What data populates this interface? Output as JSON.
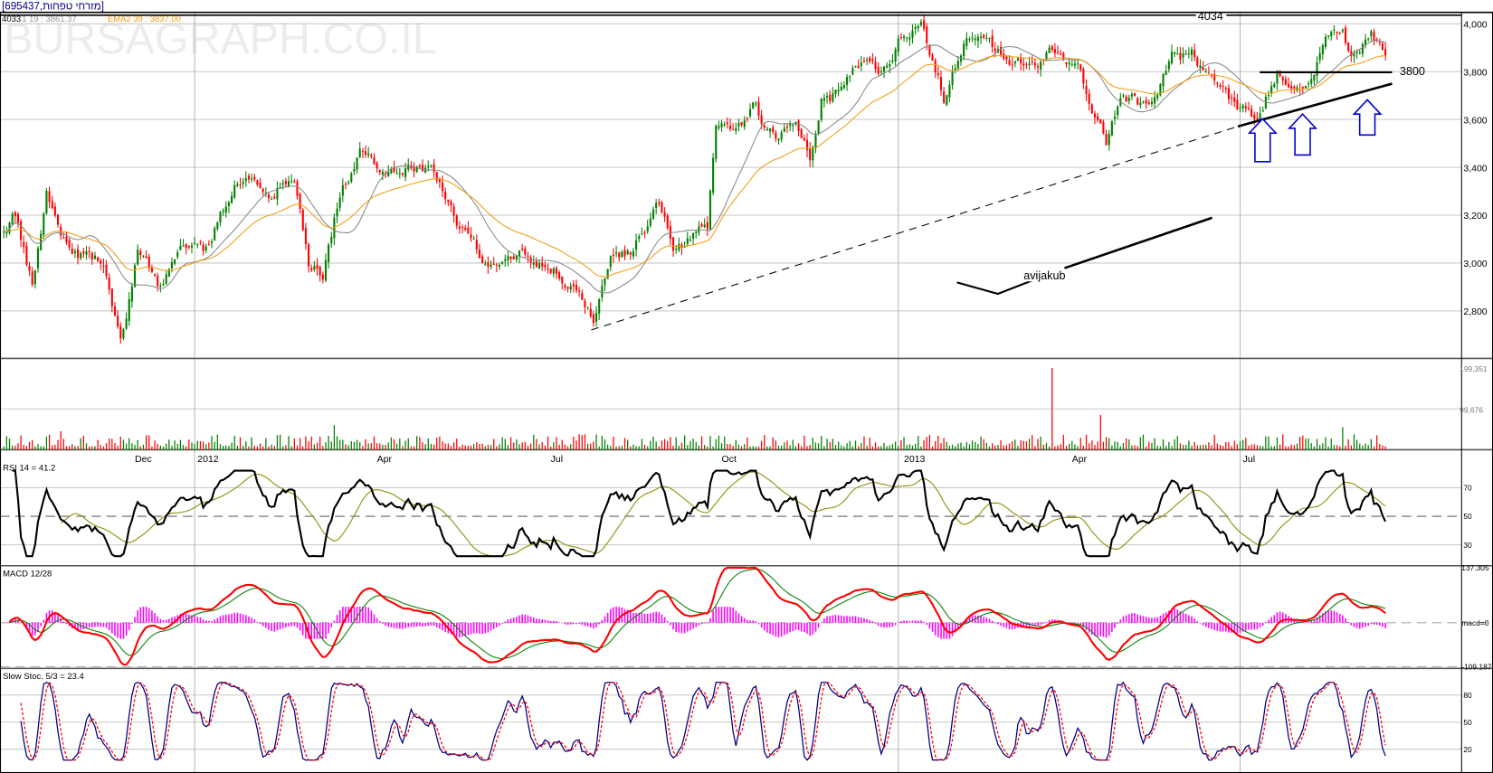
{
  "header": {
    "symbol_title": "[695437,מזרחי טפחות]",
    "last_value": "4033",
    "ma_label": "1 19 : 3861.37",
    "ema_label": "EMA2 39 : 3837.00",
    "watermark": "BURSAGRAPH.CO.IL"
  },
  "chart_data": {
    "type": "candlestick",
    "title": "[695437,מזרחי טפחות]",
    "trading_days": 486,
    "close_anchors": [
      [
        0,
        3150
      ],
      [
        4,
        3200
      ],
      [
        10,
        2900
      ],
      [
        15,
        3300
      ],
      [
        23,
        3050
      ],
      [
        35,
        3000
      ],
      [
        41,
        2650
      ],
      [
        47,
        3050
      ],
      [
        55,
        2900
      ],
      [
        62,
        3050
      ],
      [
        70,
        3050
      ],
      [
        82,
        3350
      ],
      [
        93,
        3300
      ],
      [
        102,
        3350
      ],
      [
        107,
        3000
      ],
      [
        112,
        2950
      ],
      [
        118,
        3300
      ],
      [
        125,
        3450
      ],
      [
        133,
        3400
      ],
      [
        147,
        3400
      ],
      [
        153,
        3350
      ],
      [
        160,
        3150
      ],
      [
        170,
        3000
      ],
      [
        180,
        3050
      ],
      [
        190,
        3000
      ],
      [
        200,
        2900
      ],
      [
        207,
        2750
      ],
      [
        213,
        3000
      ],
      [
        220,
        3050
      ],
      [
        230,
        3250
      ],
      [
        235,
        3050
      ],
      [
        247,
        3150
      ],
      [
        250,
        3600
      ],
      [
        257,
        3550
      ],
      [
        263,
        3650
      ],
      [
        272,
        3500
      ],
      [
        278,
        3600
      ],
      [
        283,
        3450
      ],
      [
        287,
        3700
      ],
      [
        293,
        3700
      ],
      [
        302,
        3850
      ],
      [
        310,
        3800
      ],
      [
        315,
        3950
      ],
      [
        322,
        4010
      ],
      [
        330,
        3700
      ],
      [
        338,
        3950
      ],
      [
        347,
        3900
      ],
      [
        353,
        3850
      ],
      [
        362,
        3800
      ],
      [
        367,
        3900
      ],
      [
        377,
        3800
      ],
      [
        387,
        3500
      ],
      [
        392,
        3700
      ],
      [
        402,
        3650
      ],
      [
        410,
        3850
      ],
      [
        417,
        3880
      ],
      [
        425,
        3750
      ],
      [
        433,
        3650
      ],
      [
        440,
        3600
      ],
      [
        447,
        3800
      ],
      [
        453,
        3720
      ],
      [
        458,
        3750
      ],
      [
        462,
        3850
      ],
      [
        465,
        3950
      ],
      [
        470,
        3950
      ],
      [
        473,
        3850
      ],
      [
        480,
        3950
      ],
      [
        485,
        3850
      ]
    ],
    "volume_spikes": [
      [
        368,
        199351
      ],
      [
        385,
        85000
      ],
      [
        470,
        55000
      ],
      [
        116,
        60000
      ],
      [
        20,
        45000
      ]
    ],
    "price_axis": {
      "ticks": [
        "4,000",
        "3,800",
        "3,600",
        "3,400",
        "3,200",
        "3,000",
        "2,800"
      ],
      "values": [
        4000,
        3800,
        3600,
        3400,
        3200,
        3000,
        2800
      ],
      "ylim": [
        2650,
        4060
      ]
    },
    "volume_axis": {
      "ticks": [
        "199,351",
        "99,676"
      ],
      "values": [
        199351,
        99676
      ]
    },
    "x_ticks": [
      {
        "label": "Dec",
        "day": 46
      },
      {
        "label": "2012",
        "day": 68
      },
      {
        "label": "Apr",
        "day": 131
      },
      {
        "label": "Jul",
        "day": 192
      },
      {
        "label": "Oct",
        "day": 252
      },
      {
        "label": "2013",
        "day": 316
      },
      {
        "label": "Apr",
        "day": 375
      },
      {
        "label": "Jul",
        "day": 435
      }
    ],
    "year_gridlines": [
      67,
      314,
      434
    ],
    "moving_averages": [
      {
        "name": "MA 19",
        "color": "#888888",
        "period": 19
      },
      {
        "name": "EMA 39",
        "color": "#f39c12",
        "period": 39
      }
    ],
    "annotations": {
      "resistance_label": "4034",
      "resistance_value": 4034,
      "support_label": "3800",
      "support_value": 3800,
      "signature": "avijakub",
      "arrows": 3
    },
    "rsi": {
      "label": "RSI 14 = 41.2",
      "period": 14,
      "ticks": [
        "70",
        "50",
        "30"
      ],
      "values": [
        70,
        50,
        30
      ]
    },
    "macd": {
      "label": "MACD 12/28",
      "fast": 12,
      "slow": 28,
      "ticks": [
        "137.305",
        "macd=0",
        "-109.187"
      ],
      "values": [
        137.305,
        0,
        -109.187
      ]
    },
    "stoch": {
      "label": "Slow Stoc. 5/3 = 23.4",
      "k": 5,
      "d": 3,
      "ticks": [
        "80",
        "50",
        "20"
      ],
      "values": [
        80,
        50,
        20
      ]
    }
  },
  "colors": {
    "up": "#008000",
    "down": "#ff0000",
    "ema": "#f39c12",
    "ma": "#888888",
    "rsi_signal": "#8b8b00",
    "macd": "#ff0000",
    "macd_signal": "#008000",
    "macd_hist": "#ff00ff",
    "stoch_k": "#000080",
    "stoch_d": "#ff0000",
    "arrow": "#0000cc"
  }
}
